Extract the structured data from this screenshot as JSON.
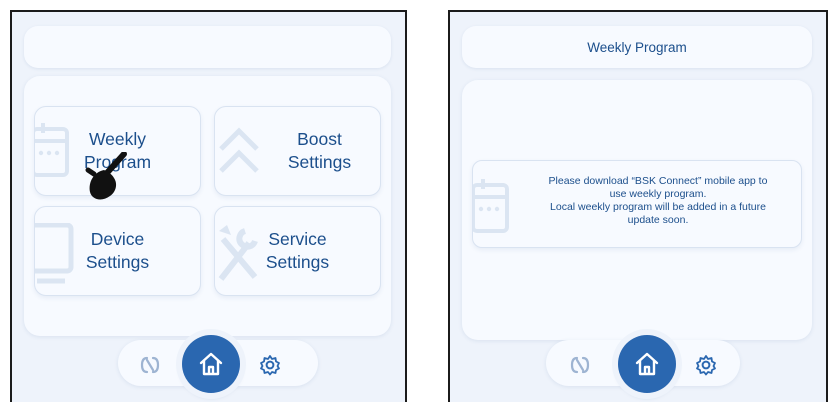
{
  "left_screen": {
    "header": {
      "title": ""
    },
    "tiles": [
      {
        "id": "weekly-program",
        "label": "Weekly\nProgram",
        "icon": "calendar-icon"
      },
      {
        "id": "boost-settings",
        "label": "Boost\nSettings",
        "icon": "chevron-up-icon"
      },
      {
        "id": "device-settings",
        "label": "Device\nSettings",
        "icon": "monitor-icon"
      },
      {
        "id": "service-settings",
        "label": "Service\nSettings",
        "icon": "tools-icon"
      }
    ],
    "overlay": {
      "icon": "pointing-hand-icon"
    }
  },
  "right_screen": {
    "header": {
      "title": "Weekly Program"
    },
    "message": {
      "icon": "calendar-icon",
      "text": "Please download “BSK Connect” mobile app to\nuse weekly program.\nLocal weekly program will be added in a future\nupdate soon."
    }
  },
  "nav": {
    "items": [
      {
        "id": "connectivity",
        "icon": "link-icon",
        "active": false
      },
      {
        "id": "home",
        "icon": "home-icon",
        "active": true
      },
      {
        "id": "settings",
        "icon": "gear-icon",
        "active": false
      }
    ]
  },
  "colors": {
    "accent": "#2a67b0",
    "text": "#1c4f8c",
    "surface": "#f7faff",
    "background": "#eef3fb",
    "icon_faint": "#dbe5f2",
    "icon_muted": "#9eb4d2"
  }
}
